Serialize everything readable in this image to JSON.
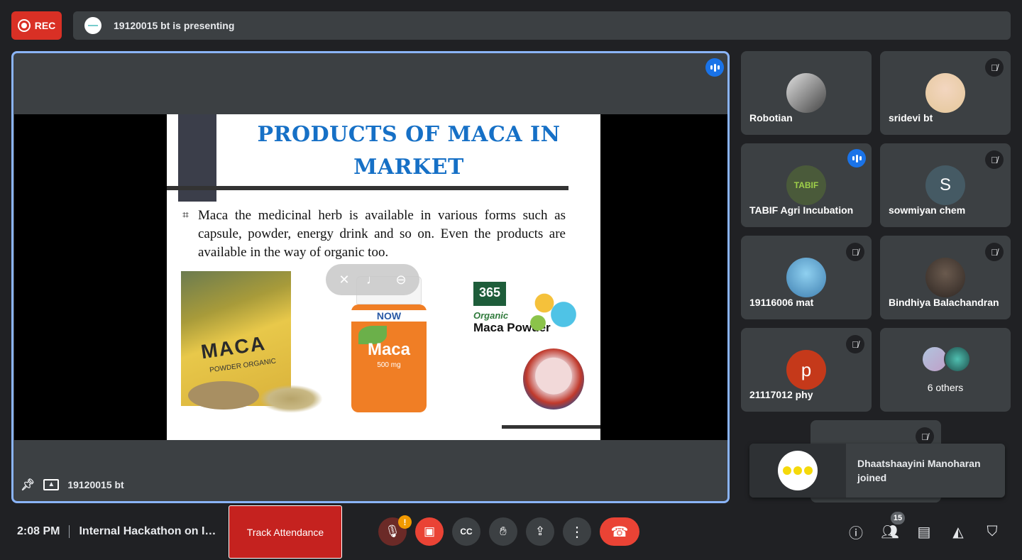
{
  "top": {
    "rec_label": "REC",
    "presenting_text": "19120015 bt is presenting"
  },
  "stage": {
    "presenter_name": "19120015 bt",
    "slide": {
      "title": "PRODUCTS OF MACA IN MARKET",
      "bullet_marker": "⌗",
      "bullet": "Maca the medicinal herb is available in various forms such as capsule, powder, energy drink and so on. Even the products are available in the way of organic too.",
      "product1": {
        "name": "MACA",
        "sub": "POWDER ORGANIC"
      },
      "product2": {
        "brand": "NOW",
        "name": "Maca",
        "dose": "500 mg"
      },
      "product3": {
        "logo": "365",
        "line1": "Organic",
        "line2": "Maca Powder"
      }
    }
  },
  "participants": [
    {
      "name": "Robotian",
      "muted": false,
      "color": "#6b6f72"
    },
    {
      "name": "sridevi bt",
      "muted": true,
      "color": "#d9c7a8"
    },
    {
      "name": "TABIF Agri Incubation",
      "muted": false,
      "speaking": true,
      "color": "#4a5a3a",
      "initial": "TABIF"
    },
    {
      "name": "sowmiyan chem",
      "muted": true,
      "color": "#455a64",
      "initial": "S"
    },
    {
      "name": "19116006 mat",
      "muted": true,
      "color": "#5fa8d3"
    },
    {
      "name": "Bindhiya Balachandran",
      "muted": true,
      "color": "#4a3f38"
    },
    {
      "name": "21117012 phy",
      "muted": true,
      "color": "#c5391a",
      "initial": "p"
    },
    {
      "name": "6 others",
      "muted": false,
      "color": "#3c4043"
    }
  ],
  "toast": {
    "text": "Dhaatshaayini Manoharan joined"
  },
  "bottom": {
    "time": "2:08 PM",
    "meeting_title": "Internal Hackathon on In...",
    "track_attendance": "Track Attendance",
    "warning_badge": "!",
    "people_count": "15"
  },
  "icons": [
    "mic-off-icon",
    "camera-off-icon",
    "captions-icon",
    "raise-hand-icon",
    "present-icon",
    "more-icon",
    "end-call-icon",
    "info-icon",
    "people-icon",
    "chat-icon",
    "activities-icon",
    "host-controls-icon"
  ]
}
